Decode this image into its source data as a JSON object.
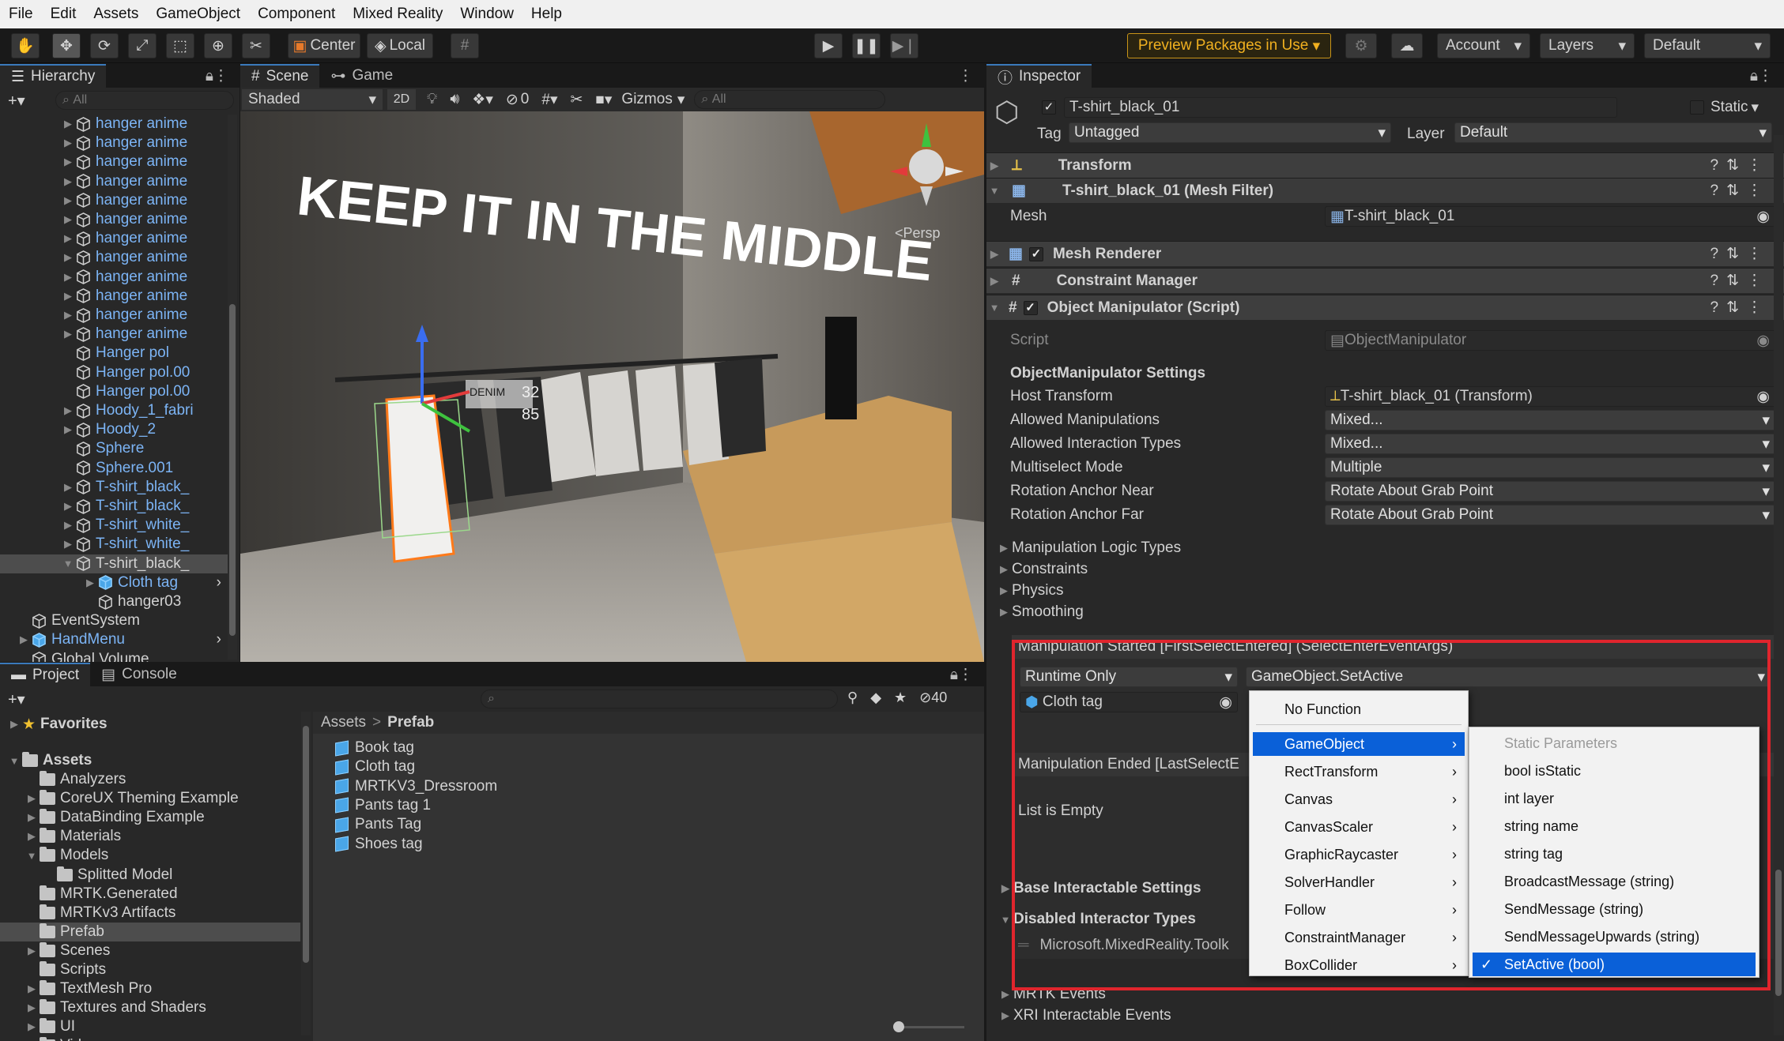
{
  "menubar": [
    "File",
    "Edit",
    "Assets",
    "GameObject",
    "Component",
    "Mixed Reality",
    "Window",
    "Help"
  ],
  "toolbar": {
    "pivot": "Center",
    "space": "Local",
    "preview_packages": "Preview Packages in Use",
    "account": "Account",
    "layers": "Layers",
    "layout": "Default"
  },
  "hierarchy": {
    "tab": "Hierarchy",
    "search_placeholder": "All",
    "items": [
      {
        "label": "hanger anime",
        "indent": 3,
        "arrow": true,
        "prefab": true
      },
      {
        "label": "hanger anime",
        "indent": 3,
        "arrow": true,
        "prefab": true
      },
      {
        "label": "hanger anime",
        "indent": 3,
        "arrow": true,
        "prefab": true
      },
      {
        "label": "hanger anime",
        "indent": 3,
        "arrow": true,
        "prefab": true
      },
      {
        "label": "hanger anime",
        "indent": 3,
        "arrow": true,
        "prefab": true
      },
      {
        "label": "hanger anime",
        "indent": 3,
        "arrow": true,
        "prefab": true
      },
      {
        "label": "hanger anime",
        "indent": 3,
        "arrow": true,
        "prefab": true
      },
      {
        "label": "hanger anime",
        "indent": 3,
        "arrow": true,
        "prefab": true
      },
      {
        "label": "hanger anime",
        "indent": 3,
        "arrow": true,
        "prefab": true
      },
      {
        "label": "hanger anime",
        "indent": 3,
        "arrow": true,
        "prefab": true
      },
      {
        "label": "hanger anime",
        "indent": 3,
        "arrow": true,
        "prefab": true
      },
      {
        "label": "hanger anime",
        "indent": 3,
        "arrow": true,
        "prefab": true
      },
      {
        "label": "Hanger pol",
        "indent": 3,
        "arrow": false,
        "prefab": true
      },
      {
        "label": "Hanger pol.00",
        "indent": 3,
        "arrow": false,
        "prefab": true
      },
      {
        "label": "Hanger pol.00",
        "indent": 3,
        "arrow": false,
        "prefab": true
      },
      {
        "label": "Hoody_1_fabri",
        "indent": 3,
        "arrow": true,
        "prefab": true
      },
      {
        "label": "Hoody_2",
        "indent": 3,
        "arrow": true,
        "prefab": true
      },
      {
        "label": "Sphere",
        "indent": 3,
        "arrow": false,
        "prefab": true
      },
      {
        "label": "Sphere.001",
        "indent": 3,
        "arrow": false,
        "prefab": true
      },
      {
        "label": "T-shirt_black_",
        "indent": 3,
        "arrow": true,
        "prefab": true
      },
      {
        "label": "T-shirt_black_",
        "indent": 3,
        "arrow": true,
        "prefab": true
      },
      {
        "label": "T-shirt_white_",
        "indent": 3,
        "arrow": true,
        "prefab": true
      },
      {
        "label": "T-shirt_white_",
        "indent": 3,
        "arrow": true,
        "prefab": true
      },
      {
        "label": "T-shirt_black_",
        "indent": 3,
        "arrow": "open",
        "prefab": false,
        "selected": true
      },
      {
        "label": "Cloth tag",
        "indent": 4,
        "arrow": true,
        "prefab": true,
        "blue": true
      },
      {
        "label": "hanger03",
        "indent": 4,
        "arrow": false,
        "prefab": false
      },
      {
        "label": "EventSystem",
        "indent": 1,
        "arrow": false,
        "prefab": false
      },
      {
        "label": "HandMenu",
        "indent": 1,
        "arrow": true,
        "prefab": true,
        "blue": true
      },
      {
        "label": "Global Volume",
        "indent": 1,
        "arrow": false,
        "prefab": false
      }
    ]
  },
  "scene": {
    "tabs": [
      "Scene",
      "Game"
    ],
    "shading": "Shaded",
    "mode_2d": "2D",
    "hidden_count": "0",
    "gizmos": "Gizmos",
    "search_placeholder": "All",
    "persp": "Persp",
    "neon": "KEEP IT IN THE MIDDLE",
    "tag_line1": "DENIM",
    "tag_price1": "32",
    "tag_price2": "85"
  },
  "project": {
    "tabs": [
      "Project",
      "Console"
    ],
    "hidden_count": "40",
    "favorites": "Favorites",
    "assets_root": "Assets",
    "folders": [
      {
        "label": "Analyzers",
        "indent": 1,
        "arrow": false
      },
      {
        "label": "CoreUX Theming Example",
        "indent": 1,
        "arrow": true
      },
      {
        "label": "DataBinding Example",
        "indent": 1,
        "arrow": true
      },
      {
        "label": "Materials",
        "indent": 1,
        "arrow": true
      },
      {
        "label": "Models",
        "indent": 1,
        "arrow": "open"
      },
      {
        "label": "Splitted Model",
        "indent": 2,
        "arrow": false
      },
      {
        "label": "MRTK.Generated",
        "indent": 1,
        "arrow": false
      },
      {
        "label": "MRTKv3 Artifacts",
        "indent": 1,
        "arrow": false
      },
      {
        "label": "Prefab",
        "indent": 1,
        "arrow": false,
        "selected": true
      },
      {
        "label": "Scenes",
        "indent": 1,
        "arrow": true
      },
      {
        "label": "Scripts",
        "indent": 1,
        "arrow": false
      },
      {
        "label": "TextMesh Pro",
        "indent": 1,
        "arrow": true
      },
      {
        "label": "Textures and Shaders",
        "indent": 1,
        "arrow": true
      },
      {
        "label": "UI",
        "indent": 1,
        "arrow": true
      },
      {
        "label": "Video",
        "indent": 1,
        "arrow": false
      }
    ],
    "breadcrumb_root": "Assets",
    "breadcrumb_current": "Prefab",
    "assets": [
      "Book tag",
      "Cloth tag",
      "MRTKV3_Dressroom",
      "Pants tag 1",
      "Pants Tag",
      "Shoes tag"
    ]
  },
  "inspector": {
    "tab": "Inspector",
    "object_name": "T-shirt_black_01",
    "static_label": "Static",
    "tag_label": "Tag",
    "tag_value": "Untagged",
    "layer_label": "Layer",
    "layer_value": "Default",
    "components": {
      "transform": "Transform",
      "mesh_filter": "T-shirt_black_01 (Mesh Filter)",
      "mesh_label": "Mesh",
      "mesh_value": "T-shirt_black_01",
      "mesh_renderer": "Mesh Renderer",
      "constraint_manager": "Constraint Manager",
      "object_manipulator": "Object Manipulator (Script)"
    },
    "script_label": "Script",
    "script_value": "ObjectManipulator",
    "settings_header": "ObjectManipulator Settings",
    "props": [
      {
        "label": "Host Transform",
        "value": "T-shirt_black_01 (Transform)",
        "kind": "object"
      },
      {
        "label": "Allowed Manipulations",
        "value": "Mixed...",
        "kind": "dropdown"
      },
      {
        "label": "Allowed Interaction Types",
        "value": "Mixed...",
        "kind": "dropdown"
      },
      {
        "label": "Multiselect Mode",
        "value": "Multiple",
        "kind": "dropdown"
      },
      {
        "label": "Rotation Anchor Near",
        "value": "Rotate About Grab Point",
        "kind": "dropdown"
      },
      {
        "label": "Rotation Anchor Far",
        "value": "Rotate About Grab Point",
        "kind": "dropdown"
      }
    ],
    "foldouts": [
      "Manipulation Logic Types",
      "Constraints",
      "Physics",
      "Smoothing"
    ],
    "event_started": "Manipulation Started [FirstSelectEntered] (SelectEnterEventArgs)",
    "runtime_mode": "Runtime Only",
    "function_value": "GameObject.SetActive",
    "target_object": "Cloth tag",
    "event_ended": "Manipulation Ended [LastSelectE",
    "list_empty": "List is Empty",
    "base_interactable": "Base Interactable Settings",
    "disabled_interactor_types": "Disabled Interactor Types",
    "interactor_type_entry": "Microsoft.MixedReality.Toolk",
    "mrtk_events": "MRTK Events",
    "xri_events": "XRI Interactable Events"
  },
  "function_menu": {
    "no_function": "No Function",
    "items": [
      "GameObject",
      "RectTransform",
      "Canvas",
      "CanvasScaler",
      "GraphicRaycaster",
      "SolverHandler",
      "Follow",
      "ConstraintManager",
      "BoxCollider"
    ],
    "selected": "GameObject"
  },
  "submenu": {
    "header": "Static Parameters",
    "items": [
      "bool isStatic",
      "int layer",
      "string name",
      "string tag",
      "BroadcastMessage (string)",
      "SendMessage (string)",
      "SendMessageUpwards (string)",
      "SetActive (bool)"
    ],
    "selected": "SetActive (bool)"
  },
  "colors": {
    "accent": "#3a79bb",
    "highlight_red": "#e0252d",
    "menu_select": "#0a60d8",
    "prefab_blue": "#7cb4f5",
    "preview_gold": "#f0b020"
  }
}
